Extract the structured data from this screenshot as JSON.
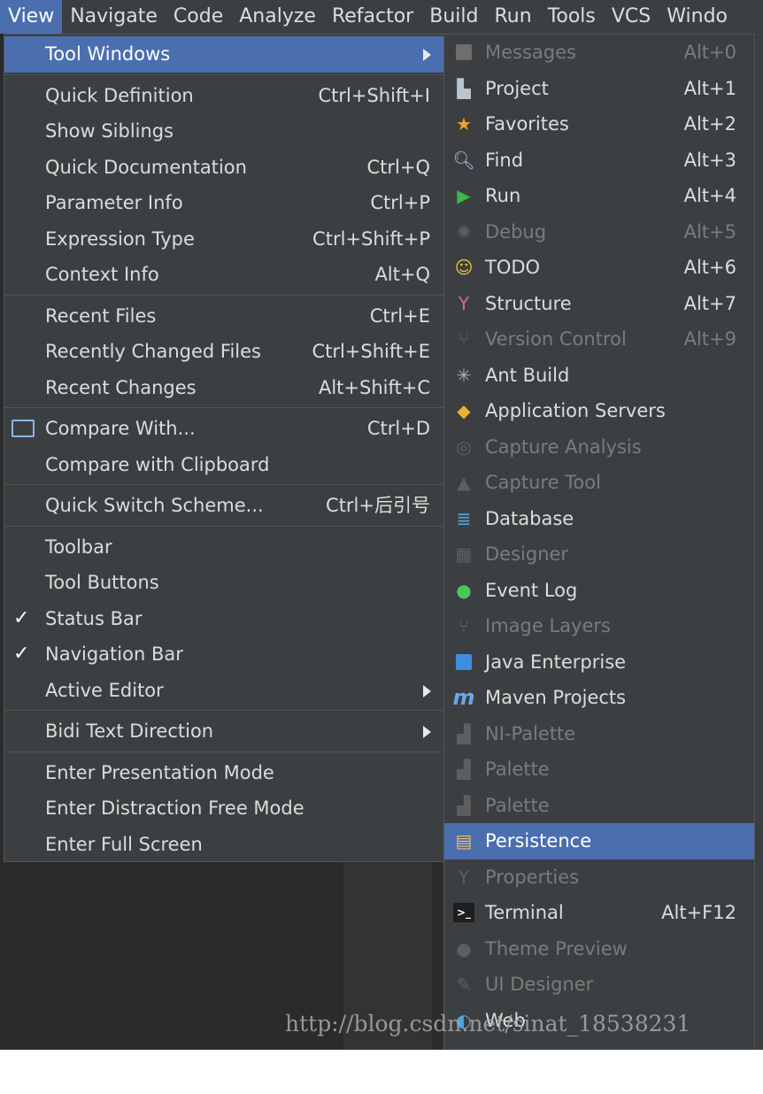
{
  "menubar": {
    "items": [
      "View",
      "Navigate",
      "Code",
      "Analyze",
      "Refactor",
      "Build",
      "Run",
      "Tools",
      "VCS",
      "Windo"
    ]
  },
  "view_menu": {
    "groups": [
      [
        {
          "label": "Tool Windows",
          "submenu": true,
          "selected": true
        }
      ],
      [
        {
          "label": "Quick Definition",
          "shortcut": "Ctrl+Shift+I"
        },
        {
          "label": "Show Siblings",
          "shortcut": ""
        },
        {
          "label": "Quick Documentation",
          "shortcut": "Ctrl+Q"
        },
        {
          "label": "Parameter Info",
          "shortcut": "Ctrl+P"
        },
        {
          "label": "Expression Type",
          "shortcut": "Ctrl+Shift+P"
        },
        {
          "label": "Context Info",
          "shortcut": "Alt+Q"
        }
      ],
      [
        {
          "label": "Recent Files",
          "shortcut": "Ctrl+E"
        },
        {
          "label": "Recently Changed Files",
          "shortcut": "Ctrl+Shift+E"
        },
        {
          "label": "Recent Changes",
          "shortcut": "Alt+Shift+C"
        }
      ],
      [
        {
          "label": "Compare With...",
          "shortcut": "Ctrl+D",
          "icon": "compare-icon"
        },
        {
          "label": "Compare with Clipboard",
          "shortcut": ""
        }
      ],
      [
        {
          "label": "Quick Switch Scheme...",
          "shortcut": "Ctrl+后引号"
        }
      ],
      [
        {
          "label": "Toolbar",
          "shortcut": ""
        },
        {
          "label": "Tool Buttons",
          "shortcut": ""
        },
        {
          "label": "Status Bar",
          "shortcut": "",
          "checked": true
        },
        {
          "label": "Navigation Bar",
          "shortcut": "",
          "checked": true
        },
        {
          "label": "Active Editor",
          "submenu": true
        }
      ],
      [
        {
          "label": "Bidi Text Direction",
          "submenu": true
        }
      ],
      [
        {
          "label": "Enter Presentation Mode",
          "shortcut": ""
        },
        {
          "label": "Enter Distraction Free Mode",
          "shortcut": ""
        },
        {
          "label": "Enter Full Screen",
          "shortcut": ""
        }
      ]
    ]
  },
  "tool_windows": [
    {
      "label": "Messages",
      "shortcut": "Alt+0",
      "disabled": true,
      "icon": "messages-icon"
    },
    {
      "label": "Project",
      "shortcut": "Alt+1",
      "icon": "project-icon"
    },
    {
      "label": "Favorites",
      "shortcut": "Alt+2",
      "icon": "star-icon"
    },
    {
      "label": "Find",
      "shortcut": "Alt+3",
      "icon": "find-icon"
    },
    {
      "label": "Run",
      "shortcut": "Alt+4",
      "icon": "run-icon"
    },
    {
      "label": "Debug",
      "shortcut": "Alt+5",
      "disabled": true,
      "icon": "debug-icon"
    },
    {
      "label": "TODO",
      "shortcut": "Alt+6",
      "icon": "todo-icon"
    },
    {
      "label": "Structure",
      "shortcut": "Alt+7",
      "icon": "structure-icon"
    },
    {
      "label": "Version Control",
      "shortcut": "Alt+9",
      "disabled": true,
      "icon": "version-control-icon"
    },
    {
      "label": "Ant Build",
      "shortcut": "",
      "icon": "ant-icon"
    },
    {
      "label": "Application Servers",
      "shortcut": "",
      "icon": "app-servers-icon"
    },
    {
      "label": "Capture Analysis",
      "shortcut": "",
      "disabled": true,
      "icon": "capture-analysis-icon"
    },
    {
      "label": "Capture Tool",
      "shortcut": "",
      "disabled": true,
      "icon": "capture-tool-icon"
    },
    {
      "label": "Database",
      "shortcut": "",
      "icon": "database-icon"
    },
    {
      "label": "Designer",
      "shortcut": "",
      "disabled": true,
      "icon": "designer-icon"
    },
    {
      "label": "Event Log",
      "shortcut": "",
      "icon": "event-log-icon"
    },
    {
      "label": "Image Layers",
      "shortcut": "",
      "disabled": true,
      "icon": "image-layers-icon"
    },
    {
      "label": "Java Enterprise",
      "shortcut": "",
      "icon": "java-enterprise-icon"
    },
    {
      "label": "Maven Projects",
      "shortcut": "",
      "icon": "maven-icon"
    },
    {
      "label": "NI-Palette",
      "shortcut": "",
      "disabled": true,
      "icon": "palette-icon"
    },
    {
      "label": "Palette",
      "shortcut": "",
      "disabled": true,
      "icon": "palette-icon"
    },
    {
      "label": "Palette",
      "shortcut": "",
      "disabled": true,
      "icon": "palette-icon"
    },
    {
      "label": "Persistence",
      "shortcut": "",
      "selected": true,
      "icon": "persistence-icon"
    },
    {
      "label": "Properties",
      "shortcut": "",
      "disabled": true,
      "icon": "properties-icon"
    },
    {
      "label": "Terminal",
      "shortcut": "Alt+F12",
      "icon": "terminal-icon"
    },
    {
      "label": "Theme Preview",
      "shortcut": "",
      "disabled": true,
      "icon": "theme-preview-icon"
    },
    {
      "label": "UI Designer",
      "shortcut": "",
      "disabled": true,
      "icon": "ui-designer-icon"
    },
    {
      "label": "Web",
      "shortcut": "",
      "icon": "web-icon"
    }
  ],
  "watermark": "http://blog.csdn.net/sinat_18538231",
  "colors": {
    "menu_bg": "#3c3f41",
    "selection": "#4b6eaf",
    "text": "#dcdcdc",
    "disabled_text": "#7b7b7b"
  }
}
